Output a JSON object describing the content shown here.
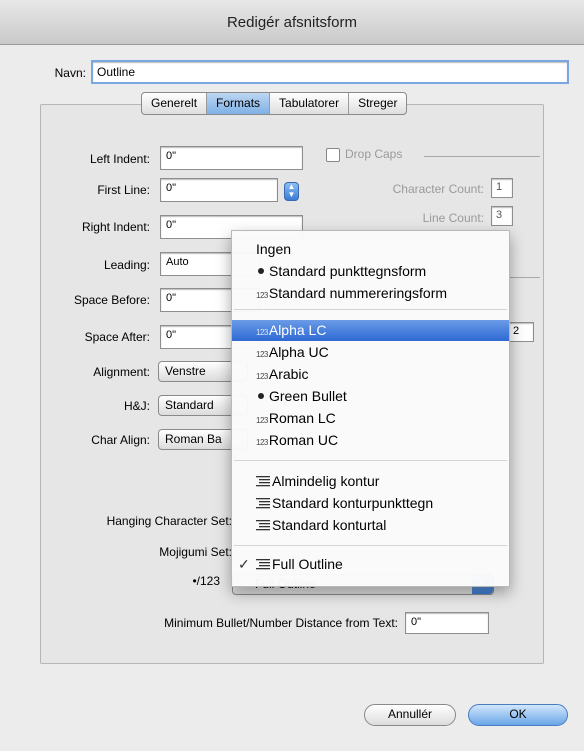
{
  "window": {
    "title": "Redigér afsnitsform"
  },
  "name_row": {
    "label": "Navn:",
    "value": "Outline"
  },
  "tabs": [
    {
      "label": "Generelt",
      "active": false
    },
    {
      "label": "Formats",
      "active": true
    },
    {
      "label": "Tabulatorer",
      "active": false
    },
    {
      "label": "Streger",
      "active": false
    }
  ],
  "formats": {
    "left_indent": {
      "label": "Left Indent:",
      "value": "0\""
    },
    "first_line": {
      "label": "First Line:",
      "value": "0\""
    },
    "right_indent": {
      "label": "Right Indent:",
      "value": "0\""
    },
    "leading": {
      "label": "Leading:",
      "value": "Auto"
    },
    "space_before": {
      "label": "Space Before:",
      "value": "0\""
    },
    "space_after": {
      "label": "Space After:",
      "value": "0\""
    },
    "alignment": {
      "label": "Alignment:",
      "value": "Venstre"
    },
    "hj": {
      "label": "H&J:",
      "value": "Standard"
    },
    "char_align": {
      "label": "Char Align:",
      "value": "Roman Ba"
    },
    "drop_caps": {
      "label": "Drop Caps",
      "checked": false
    },
    "character_count": {
      "label": "Character Count:",
      "value": "1"
    },
    "line_count": {
      "label": "Line Count:",
      "value": "3"
    },
    "partial_value": "2",
    "hanging_char_set": {
      "label": "Hanging Character Set:"
    },
    "mojigumi_set": {
      "label": "Mojigumi Set:"
    },
    "bullet_number": {
      "label": "•/123",
      "value": "Full Outline"
    },
    "min_distance": {
      "label": "Minimum Bullet/Number Distance from Text:",
      "value": "0\""
    }
  },
  "menu": {
    "icon_numbers": "123",
    "icon_check": "✓",
    "items": [
      {
        "label": "Ingen",
        "icon": "none"
      },
      {
        "label": "Standard punkttegnsform",
        "icon": "bullet"
      },
      {
        "label": "Standard nummereringsform",
        "icon": "numbers"
      },
      {
        "label": "Alpha LC",
        "icon": "numbers",
        "highlighted": true
      },
      {
        "label": "Alpha UC",
        "icon": "numbers"
      },
      {
        "label": "Arabic",
        "icon": "numbers"
      },
      {
        "label": "Green Bullet",
        "icon": "bullet"
      },
      {
        "label": "Roman LC",
        "icon": "numbers"
      },
      {
        "label": "Roman UC",
        "icon": "numbers"
      },
      {
        "label": "Almindelig kontur",
        "icon": "outline"
      },
      {
        "label": "Standard konturpunkttegn",
        "icon": "outline"
      },
      {
        "label": "Standard konturtal",
        "icon": "outline"
      },
      {
        "label": "Full Outline",
        "icon": "outline",
        "checked": true
      }
    ]
  },
  "buttons": {
    "cancel": "Annullér",
    "ok": "OK"
  },
  "colors": {
    "accent": "#2e69d4",
    "highlight": "#6a9be6"
  }
}
